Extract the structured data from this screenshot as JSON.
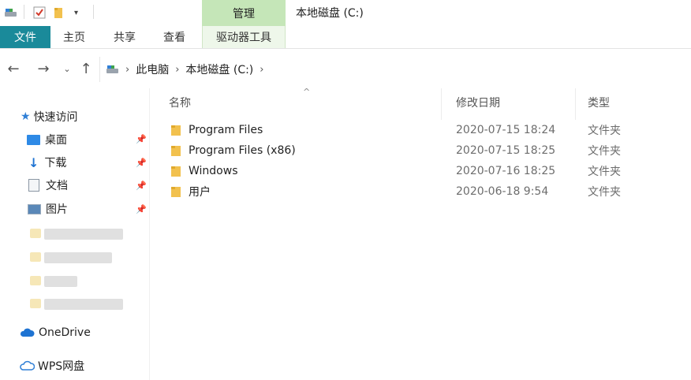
{
  "window": {
    "title": "本地磁盘 (C:)"
  },
  "ribbon": {
    "context_group": "管理",
    "tabs": [
      {
        "label": "文件"
      },
      {
        "label": "主页"
      },
      {
        "label": "共享"
      },
      {
        "label": "查看"
      },
      {
        "label": "驱动器工具"
      }
    ]
  },
  "address": {
    "crumbs": [
      "此电脑",
      "本地磁盘 (C:)"
    ]
  },
  "sidebar": {
    "quick_access": "快速访问",
    "pinned": [
      {
        "label": "桌面"
      },
      {
        "label": "下载"
      },
      {
        "label": "文档"
      },
      {
        "label": "图片"
      }
    ],
    "onedrive": "OneDrive",
    "wps": "WPS网盘"
  },
  "columns": {
    "name": "名称",
    "date": "修改日期",
    "type": "类型"
  },
  "files": [
    {
      "name": "Program Files",
      "date": "2020-07-15 18:24",
      "type": "文件夹"
    },
    {
      "name": "Program Files (x86)",
      "date": "2020-07-15 18:25",
      "type": "文件夹"
    },
    {
      "name": "Windows",
      "date": "2020-07-16 18:25",
      "type": "文件夹"
    },
    {
      "name": "用户",
      "date": "2020-06-18 9:54",
      "type": "文件夹"
    }
  ],
  "colors": {
    "file_tab": "#1a8a9a",
    "manage_tab": "#c5e6b8",
    "folder": "#f2c14e",
    "accent_blue": "#1e73d2"
  }
}
